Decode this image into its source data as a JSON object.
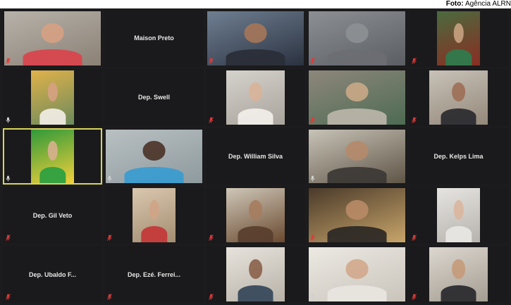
{
  "credit": {
    "label": "Foto:",
    "source": "Agência ALRN"
  },
  "colors": {
    "background": "#1c1c1e",
    "active_speaker_border": "#d8d55a",
    "mute_icon": "#e03a3a"
  },
  "participants": [
    {
      "kind": "video",
      "name": "",
      "muted": true,
      "c1": "#b7b2aa",
      "c2": "#8b8175",
      "skin": "#d6a183",
      "shirt": "#d8464d",
      "fit": "full"
    },
    {
      "kind": "name",
      "name": "Maison Preto",
      "muted": false
    },
    {
      "kind": "video",
      "name": "",
      "muted": true,
      "c1": "#6f7f92",
      "c2": "#2b3240",
      "skin": "#a57759",
      "shirt": "#2a2e38",
      "fit": "full"
    },
    {
      "kind": "video",
      "name": "",
      "muted": true,
      "c1": "#8c8f93",
      "c2": "#5b5e63",
      "skin": "#8d9094",
      "shirt": "#6b6e73",
      "fit": "full"
    },
    {
      "kind": "video",
      "name": "",
      "muted": true,
      "c1": "#4a6b3f",
      "c2": "#8a2d22",
      "skin": "#c8a27f",
      "shirt": "#2f7a4d",
      "fit": "small"
    },
    {
      "kind": "video",
      "name": "",
      "muted": false,
      "c1": "#e0b24a",
      "c2": "#6d8a5c",
      "skin": "#d6a183",
      "shirt": "#efeae2",
      "fit": "small"
    },
    {
      "kind": "name",
      "name": "Dep. Swell",
      "muted": false
    },
    {
      "kind": "video",
      "name": "",
      "muted": true,
      "c1": "#d5d2cc",
      "c2": "#a9a49c",
      "skin": "#d9b299",
      "shirt": "#f0ede8",
      "fit": "mid"
    },
    {
      "kind": "video",
      "name": "",
      "muted": true,
      "c1": "#8e877c",
      "c2": "#4d6b52",
      "skin": "#c9a887",
      "shirt": "#b8b3a8",
      "fit": "full"
    },
    {
      "kind": "video",
      "name": "",
      "muted": true,
      "c1": "#c8c2b8",
      "c2": "#94887a",
      "skin": "#9d6e55",
      "shirt": "#2d2d31",
      "fit": "mid"
    },
    {
      "kind": "video",
      "name": "",
      "muted": false,
      "c1": "#2f9a3a",
      "c2": "#f2cf3b",
      "skin": "#d8b08f",
      "shirt": "#2ea040",
      "fit": "small",
      "active": true
    },
    {
      "kind": "video",
      "name": "",
      "muted": false,
      "c1": "#b9c0c2",
      "c2": "#8e9a9e",
      "skin": "#4a3227",
      "shirt": "#3b9ccf",
      "fit": "full"
    },
    {
      "kind": "name",
      "name": "Dep. William Silva",
      "muted": false
    },
    {
      "kind": "video",
      "name": "",
      "muted": false,
      "c1": "#c8c3b7",
      "c2": "#5f5547",
      "skin": "#b58a6a",
      "shirt": "#3d3a37",
      "fit": "full"
    },
    {
      "kind": "name",
      "name": "Dep. Kelps Lima",
      "muted": false
    },
    {
      "kind": "name",
      "name": "Dep. Gil Veto",
      "muted": true
    },
    {
      "kind": "video",
      "name": "",
      "muted": true,
      "c1": "#d9c7ae",
      "c2": "#a48e72",
      "skin": "#d0a487",
      "shirt": "#c33a3a",
      "fit": "small"
    },
    {
      "kind": "video",
      "name": "",
      "muted": true,
      "c1": "#cfc7b8",
      "c2": "#6a4a30",
      "skin": "#a67c5e",
      "shirt": "#5a3f2e",
      "fit": "mid"
    },
    {
      "kind": "video",
      "name": "",
      "muted": true,
      "c1": "#4a3a2a",
      "c2": "#c8a56a",
      "skin": "#b88b66",
      "shirt": "#2e2a26",
      "fit": "full"
    },
    {
      "kind": "video",
      "name": "",
      "muted": true,
      "c1": "#e6e4e0",
      "c2": "#b6b3ae",
      "skin": "#d9b69d",
      "shirt": "#e8e6e2",
      "fit": "small"
    },
    {
      "kind": "name",
      "name": "Dep. Ubaldo F...",
      "muted": true
    },
    {
      "kind": "name",
      "name": "Dep. Ezé. Ferrei...",
      "muted": true
    },
    {
      "kind": "video",
      "name": "",
      "muted": true,
      "c1": "#e7e3dc",
      "c2": "#b8b2a8",
      "skin": "#8a6149",
      "shirt": "#3a4a5c",
      "fit": "mid"
    },
    {
      "kind": "video",
      "name": "",
      "muted": false,
      "c1": "#ece9e3",
      "c2": "#c9c4bb",
      "skin": "#d2a98c",
      "shirt": "#e8e5df",
      "fit": "full"
    },
    {
      "kind": "video",
      "name": "",
      "muted": true,
      "c1": "#dcd7cf",
      "c2": "#a49d92",
      "skin": "#c59a7a",
      "shirt": "#2c2c30",
      "fit": "mid"
    }
  ]
}
